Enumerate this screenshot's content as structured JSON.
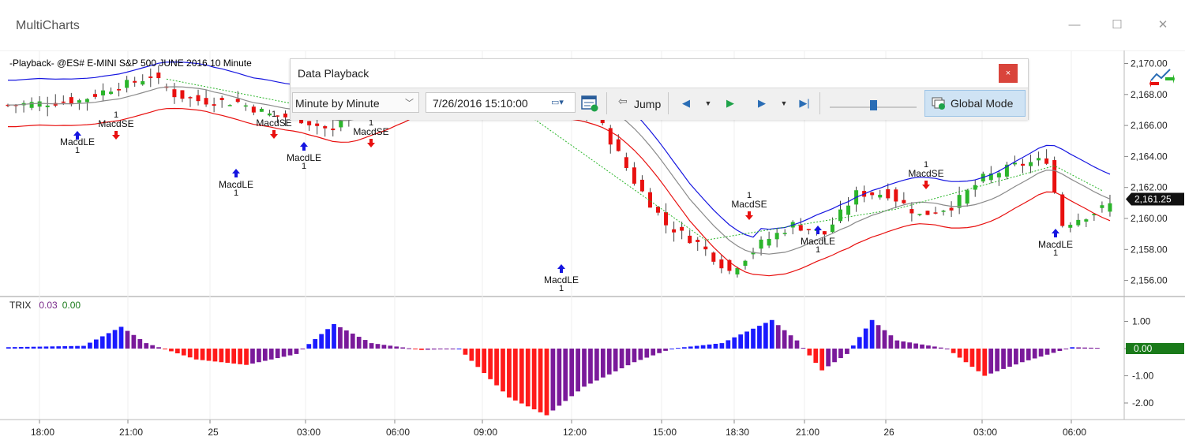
{
  "window": {
    "title": "MultiCharts",
    "minimize_glyph": "—",
    "maximize_glyph": "☐",
    "close_glyph": "✕"
  },
  "chart": {
    "header": "-Playback-  @ES#  E-MINI S&P 500 JUNE 2016  10 Minute",
    "price_axis_labels": [
      "2,170.00",
      "2,168.00",
      "2,166.00",
      "2,164.00",
      "2,162.00",
      "2,160.00",
      "2,158.00",
      "2,156.00"
    ],
    "last_price": "2,161.25",
    "time_axis_labels": [
      "18:00",
      "21:00",
      "25",
      "03:00",
      "06:00",
      "09:00",
      "12:00",
      "15:00",
      "18:30",
      "21:00",
      "26",
      "03:00",
      "06:00"
    ],
    "signals": [
      {
        "label": "MacdLE",
        "qty": "1",
        "type": "long"
      },
      {
        "label": "MacdSE",
        "qty": "1",
        "type": "short"
      },
      {
        "label": "MacdLE",
        "qty": "1",
        "type": "long"
      },
      {
        "label": "MacdSE",
        "qty": "1",
        "type": "short"
      },
      {
        "label": "MacdLE",
        "qty": "1",
        "type": "long"
      },
      {
        "label": "MacdSE",
        "qty": "1",
        "type": "short"
      },
      {
        "label": "MacdLE",
        "qty": "1",
        "type": "long"
      },
      {
        "label": "MacdSE",
        "qty": "1",
        "type": "short"
      },
      {
        "label": "MacdLE",
        "qty": "1",
        "type": "long"
      },
      {
        "label": "MacdSE",
        "qty": "1",
        "type": "short"
      },
      {
        "label": "MacdLE",
        "qty": "1",
        "type": "long"
      }
    ],
    "colors": {
      "up": "#2bb52b",
      "down": "#e8100f",
      "upper_band": "#1515e0",
      "mid_band": "#8a8a8a",
      "lower_band": "#e8100f",
      "trade_line": "#29b529"
    }
  },
  "trix": {
    "name": "TRIX",
    "value1": "0.03",
    "value2": "0.00",
    "axis_labels": [
      "1.00",
      "0.00",
      "-1.00",
      "-2.00"
    ],
    "current": "0.00",
    "colors": {
      "pos_rising": "#1a1aff",
      "pos_falling": "#7a1a9a",
      "neg_falling": "#ff1a1a",
      "neg_rising": "#7a1a9a"
    }
  },
  "playback": {
    "title": "Data Playback",
    "close_glyph": "×",
    "mode": "Minute by Minute",
    "datetime": "7/26/2016 15:10:00",
    "jump_label": "Jump",
    "global_mode_label": "Global Mode",
    "slider_position": 0.5
  }
}
